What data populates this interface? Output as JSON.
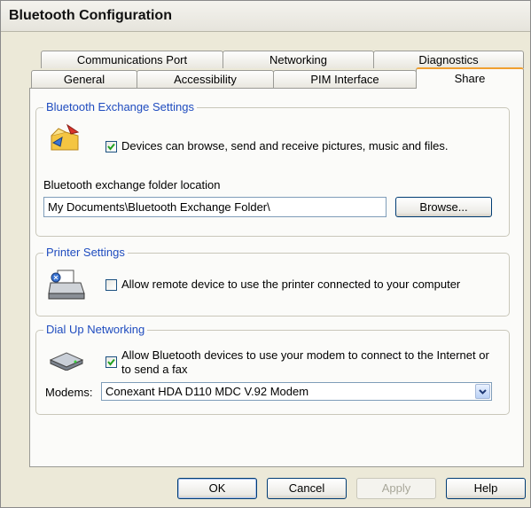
{
  "window": {
    "title": "Bluetooth Configuration"
  },
  "tabs": {
    "row_back": [
      "Communications Port",
      "Networking",
      "Diagnostics"
    ],
    "row_front": [
      "General",
      "Accessibility",
      "PIM Interface",
      "Share"
    ],
    "active": "Share"
  },
  "exchange": {
    "group_label": "Bluetooth Exchange Settings",
    "checkbox_label": "Devices can browse, send and receive pictures, music and files.",
    "checked": true,
    "folder_label": "Bluetooth exchange folder location",
    "folder_value": "My Documents\\Bluetooth Exchange Folder\\",
    "browse_label": "Browse..."
  },
  "printer": {
    "group_label": "Printer Settings",
    "checkbox_label": "Allow remote device to use the printer connected to your computer",
    "checked": false
  },
  "dialup": {
    "group_label": "Dial Up Networking",
    "checkbox_label_line1": "Allow Bluetooth devices to use your modem to connect to the Internet or",
    "checkbox_label_line2": "to send a fax",
    "checked": true,
    "modems_label": "Modems:",
    "modem_value": "Conexant HDA D110 MDC V.92 Modem"
  },
  "buttons": {
    "ok": "OK",
    "cancel": "Cancel",
    "apply": "Apply",
    "help": "Help"
  },
  "icons": {
    "exchange": "folder-transfer-icon",
    "printer": "printer-icon",
    "modem": "modem-icon",
    "dropdown": "chevron-down-icon"
  }
}
